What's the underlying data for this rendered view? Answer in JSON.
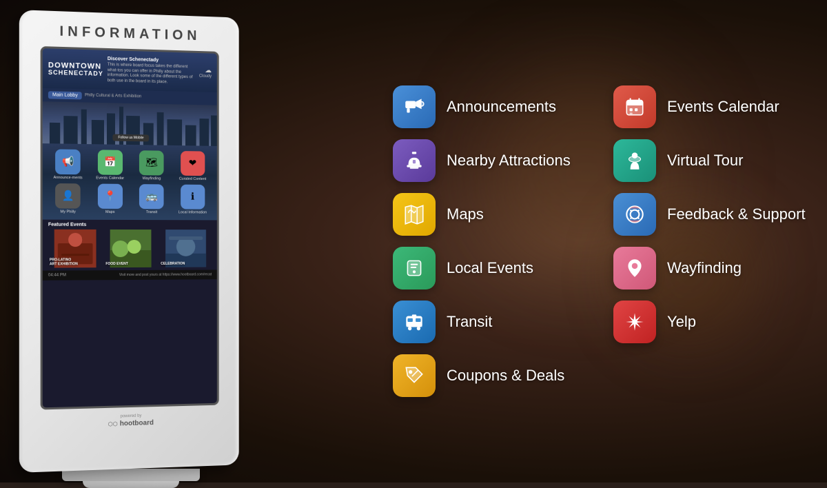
{
  "kiosk": {
    "title": "INFORMATION",
    "screen": {
      "city": "SCHENECTADY",
      "subtitle": "Discover Schenectady",
      "description": "This is where board focus takes the different what-tos you can offer in Philly about the information. Look some of the different types of both use in the board in its place.",
      "weather": "Cloudy",
      "location": "Main Lobby",
      "location2": "Philly Cultural & Arts Exhibition",
      "time": "04:44 PM",
      "url": "Visit more and post yours at https://www.hootboard.com/recat",
      "powered_by": "powered by",
      "brand": "hootboard"
    },
    "mini_apps": [
      {
        "label": "Announcements",
        "color": "#4a80c4",
        "icon": "📢"
      },
      {
        "label": "Events Calendar",
        "color": "#5ab870",
        "icon": "📅"
      },
      {
        "label": "Wayfinding",
        "color": "#4a9a60",
        "icon": "🗺"
      },
      {
        "label": "Curated Content",
        "color": "#e05050",
        "icon": "❤"
      },
      {
        "label": "My Philly",
        "color": "#555",
        "icon": "👤"
      },
      {
        "label": "Maps",
        "color": "#5a8ad0",
        "icon": "📍"
      },
      {
        "label": "Transit",
        "color": "#5a8ad0",
        "icon": "🚌"
      },
      {
        "label": "Local Information",
        "color": "#5a8ad0",
        "icon": "ℹ"
      }
    ],
    "featured_events": [
      {
        "label": "PRO-LATINO ART EXHIBITION",
        "bg": "#8a3020"
      },
      {
        "label": "FOOD EVENT",
        "bg": "#4a7030"
      },
      {
        "label": "CELEBRATION",
        "bg": "#304a70"
      }
    ]
  },
  "menu": {
    "left_column": [
      {
        "id": "announcements",
        "label": "Announcements",
        "color_class": "ic-blue",
        "icon": "announce"
      },
      {
        "id": "nearby-attractions",
        "label": "Nearby Attractions",
        "color_class": "ic-purple",
        "icon": "liberty"
      },
      {
        "id": "maps",
        "label": "Maps",
        "color_class": "ic-yellow",
        "icon": "map"
      },
      {
        "id": "local-events",
        "label": "Local Events",
        "color_class": "ic-green",
        "icon": "events"
      },
      {
        "id": "transit",
        "label": "Transit",
        "color_class": "ic-blue2",
        "icon": "bus"
      },
      {
        "id": "coupons",
        "label": "Coupons & Deals",
        "color_class": "ic-gold",
        "icon": "coupon"
      }
    ],
    "right_column": [
      {
        "id": "events-calendar",
        "label": "Events Calendar",
        "color_class": "ic-red",
        "icon": "calendar"
      },
      {
        "id": "virtual-tour",
        "label": "Virtual Tour",
        "color_class": "ic-teal",
        "icon": "tour"
      },
      {
        "id": "feedback",
        "label": "Feedback & Support",
        "color_class": "ic-blue3",
        "icon": "support"
      },
      {
        "id": "wayfinding",
        "label": "Wayfinding",
        "color_class": "ic-pink",
        "icon": "pin"
      },
      {
        "id": "yelp",
        "label": "Yelp",
        "color_class": "ic-red2",
        "icon": "yelp"
      }
    ]
  }
}
